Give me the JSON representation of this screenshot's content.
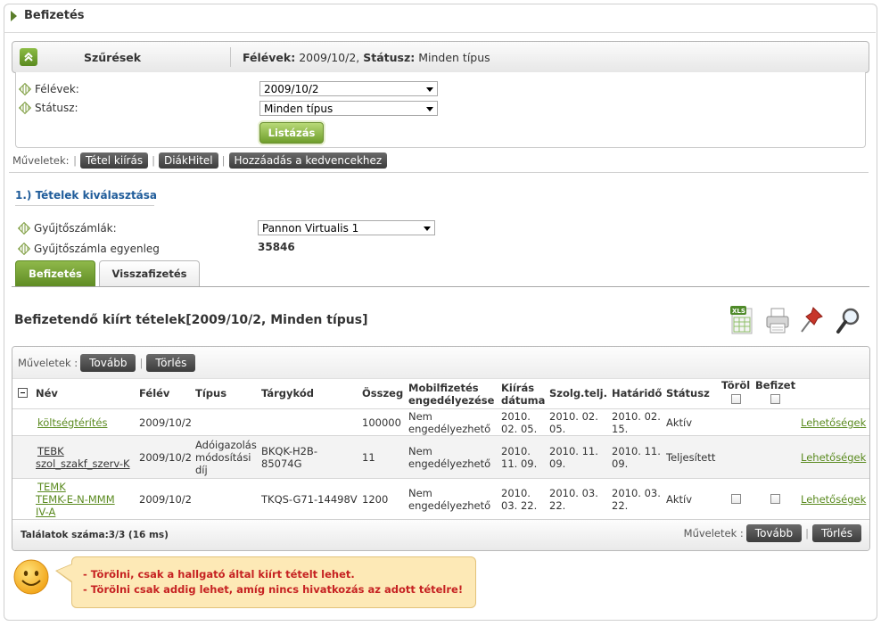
{
  "page": {
    "title": "Befizetés"
  },
  "filters": {
    "toggle_label": "Szűrések",
    "summary_semesters_label": "Félévek:",
    "summary_semesters_value": " 2009/10/2, ",
    "summary_status_label": "Státusz:",
    "summary_status_value": " Minden típus",
    "semesters_label": "Félévek:",
    "semesters_value": "2009/10/2",
    "status_label": "Státusz:",
    "status_value": "Minden típus",
    "list_button": "Listázás"
  },
  "operations": {
    "label": "Műveletek:",
    "buttons": [
      "Tétel kiírás",
      "DiákHitel",
      "Hozzáadás a kedvencekhez"
    ]
  },
  "section": {
    "title": "1.) Tételek kiválasztása"
  },
  "account": {
    "label": "Gyűjtőszámlák:",
    "value": "Pannon Virtualis 1",
    "balance_label": "Gyűjtőszámla egyenleg",
    "balance_value": "35846"
  },
  "tabs": [
    {
      "label": "Befizetés",
      "active": true
    },
    {
      "label": "Visszafizetés",
      "active": false
    }
  ],
  "list": {
    "title": "Befizetendő kiírt tételek[2009/10/2, Minden típus]",
    "toolbar_icons": [
      "xls-export-icon",
      "print-icon",
      "pin-icon",
      "search-icon"
    ],
    "ops_label": "Műveletek :",
    "next_button": "Tovább",
    "delete_button": "Törlés"
  },
  "table": {
    "columns": {
      "name": "Név",
      "semester": "Félév",
      "type": "Típus",
      "subject_code": "Tárgykód",
      "amount": "Összeg",
      "mobile_1": "Mobilfizetés",
      "mobile_2": "engedélyezése",
      "issue_1": "Kiírás",
      "issue_2": "dátuma",
      "service": "Szolg.telj.",
      "deadline": "Határidő",
      "status": "Státusz",
      "delete": "Töröl",
      "pay": "Befizet"
    },
    "rows": [
      {
        "name_1": "költségtérítés",
        "name_2": "",
        "name_3": "",
        "semester": "2009/10/2",
        "type_1": "",
        "type_2": "",
        "type_3": "",
        "code_1": "",
        "code_2": "",
        "amount": "100000",
        "mobile_1": "Nem",
        "mobile_2": "engedélyezhető",
        "issue_1": "2010.",
        "issue_2": "02. 05.",
        "service_1": "2010. 02.",
        "service_2": "05.",
        "deadline_1": "2010. 02.",
        "deadline_2": "15.",
        "status": "Aktív",
        "action": "Lehetőségek"
      },
      {
        "name_1": "TEBK",
        "name_2": "szol_szakf_szerv-K",
        "name_3": "",
        "semester": "2009/10/2",
        "type_1": "Adóigazolás",
        "type_2": "módosítási",
        "type_3": "díj",
        "code_1": "BKQK-H2B-",
        "code_2": "85074G",
        "amount": "11",
        "mobile_1": "Nem",
        "mobile_2": "engedélyezhető",
        "issue_1": "2010.",
        "issue_2": "11. 09.",
        "service_1": "2010. 11.",
        "service_2": "09.",
        "deadline_1": "2010. 11.",
        "deadline_2": "09.",
        "status": "Teljesített",
        "action": "Lehetőségek"
      },
      {
        "name_1": "TEMK",
        "name_2": "TEMK-E-N-MMM",
        "name_3": "IV-A",
        "semester": "2009/10/2",
        "type_1": "",
        "type_2": "",
        "type_3": "",
        "code_1": "TKQS-G71-14498V",
        "code_2": "",
        "amount": "1200",
        "mobile_1": "Nem",
        "mobile_2": "engedélyezhető",
        "issue_1": "2010.",
        "issue_2": "03. 22.",
        "service_1": "2010. 03.",
        "service_2": "22.",
        "deadline_1": "2010. 03.",
        "deadline_2": "22.",
        "status": "Aktív",
        "action": "Lehetőségek"
      }
    ],
    "footer_count": "Találatok száma:3/3 (16 ms)",
    "footer_ops_label": "Műveletek :"
  },
  "help": {
    "lines": [
      "- Törölni, csak a hallgató által kiírt tételt lehet.",
      "- Törölni csak addig lehet, amíg nincs hivatkozás az adott tételre!"
    ]
  },
  "colors": {
    "accent_green": "#6f9e2c",
    "link_green": "#5a8a1f",
    "section_blue": "#1f5c9a",
    "help_red": "#c62222",
    "help_bg": "#fde9b6"
  }
}
